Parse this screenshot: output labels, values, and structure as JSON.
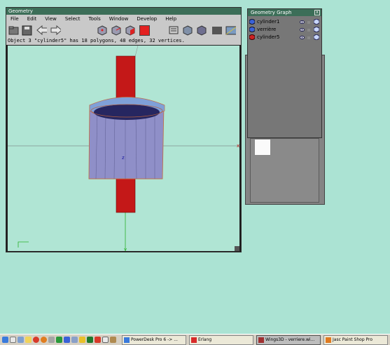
{
  "geometry_window": {
    "title": "Geometry",
    "menu": [
      "File",
      "Edit",
      "View",
      "Select",
      "Tools",
      "Window",
      "Develop",
      "Help"
    ],
    "status": "Object 3 \"cylinder5\" has 18 polygons, 48 edges, 32 vertices.",
    "axis_labels": {
      "x": "x",
      "y": "y",
      "z": "z"
    }
  },
  "graph_window": {
    "title": "Geometry Graph",
    "close_label": "x",
    "items": [
      {
        "label": "cylinder1",
        "color": "#3a62d8",
        "selected": false
      },
      {
        "label": "verrière",
        "color": "#3a62d8",
        "selected": false
      },
      {
        "label": "cylinder5",
        "color": "#cc2222",
        "selected": true
      }
    ]
  },
  "taskbar": {
    "tasks": [
      {
        "label": "PowerDesk Pro 6 -> ...",
        "active": false
      },
      {
        "label": "Erlang",
        "active": false
      },
      {
        "label": "Wings3D - verriere.wi...",
        "active": true
      },
      {
        "label": "Jasc Paint Shop Pro",
        "active": false
      }
    ]
  },
  "colors": {
    "background": "#abe3d3",
    "viewport_bg": "#b0e5d4",
    "title_bar": "#3c6e58",
    "cylinder_body": "#8f8fc8",
    "red_pole": "#c41818"
  }
}
